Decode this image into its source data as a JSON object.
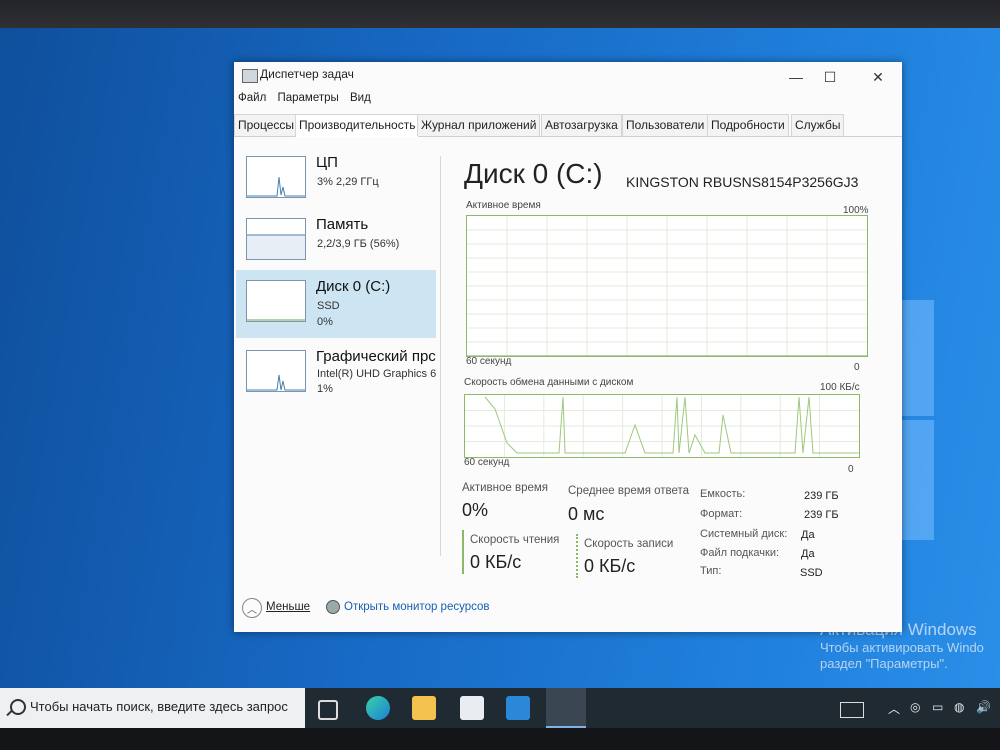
{
  "window": {
    "title": "Диспетчер задач",
    "controls": {
      "minimize": "—",
      "maximize": "☐",
      "close": "✕"
    },
    "menu": [
      "Файл",
      "Параметры",
      "Вид"
    ],
    "tabs": [
      "Процессы",
      "Производительность",
      "Журнал приложений",
      "Автозагрузка",
      "Пользователи",
      "Подробности",
      "Службы"
    ],
    "active_tab": "Производительность"
  },
  "resources": [
    {
      "name": "ЦП",
      "sub1": "3%  2,29 ГГц",
      "sub2": ""
    },
    {
      "name": "Память",
      "sub1": "2,2/3,9 ГБ (56%)",
      "sub2": ""
    },
    {
      "name": "Диск 0 (C:)",
      "sub1": "SSD",
      "sub2": "0%"
    },
    {
      "name": "Графический прс",
      "sub1": "Intel(R) UHD Graphics 6",
      "sub2": "1%"
    }
  ],
  "detail": {
    "title": "Диск 0 (C:)",
    "model": "KINGSTON RBUSNS8154P3256GJ3",
    "graph1": {
      "label": "Активное время",
      "max": "100%",
      "time": "60 секунд",
      "min": "0"
    },
    "graph2": {
      "label": "Скорость обмена данными с диском",
      "max": "100 КБ/с",
      "time": "60 секунд",
      "min": "0"
    },
    "stats": {
      "active_time_label": "Активное время",
      "active_time_value": "0%",
      "avg_response_label": "Среднее время ответа",
      "avg_response_value": "0 мс",
      "read_label": "Скорость чтения",
      "read_value": "0 КБ/с",
      "write_label": "Скорость записи",
      "write_value": "0 КБ/с"
    },
    "props": [
      {
        "k": "Емкость:",
        "v": "239 ГБ"
      },
      {
        "k": "Формат:",
        "v": "239 ГБ"
      },
      {
        "k": "Системный диск:",
        "v": "Да"
      },
      {
        "k": "Файл подкачки:",
        "v": "Да"
      },
      {
        "k": "Тип:",
        "v": "SSD"
      }
    ]
  },
  "footer": {
    "less": "Меньше",
    "monitor": "Открыть монитор ресурсов"
  },
  "desktop": {
    "activation_title": "Активация Windows",
    "activation_line1": "Чтобы активировать Windo",
    "activation_line2": "раздел \"Параметры\"."
  },
  "taskbar": {
    "search_placeholder": "Чтобы начать поиск, введите здесь запрос"
  },
  "chart_data": {
    "type": "line",
    "title": "",
    "series": [
      {
        "name": "",
        "x": [
          0,
          10,
          20,
          30,
          40,
          50,
          60
        ],
        "values": [
          0,
          0,
          0,
          0,
          0,
          0,
          0
        ]
      }
    ]
  },
  "colors": {
    "accent_graph": "#8db86a",
    "selected": "#cde4f2",
    "spark": "#4a7fb0"
  }
}
